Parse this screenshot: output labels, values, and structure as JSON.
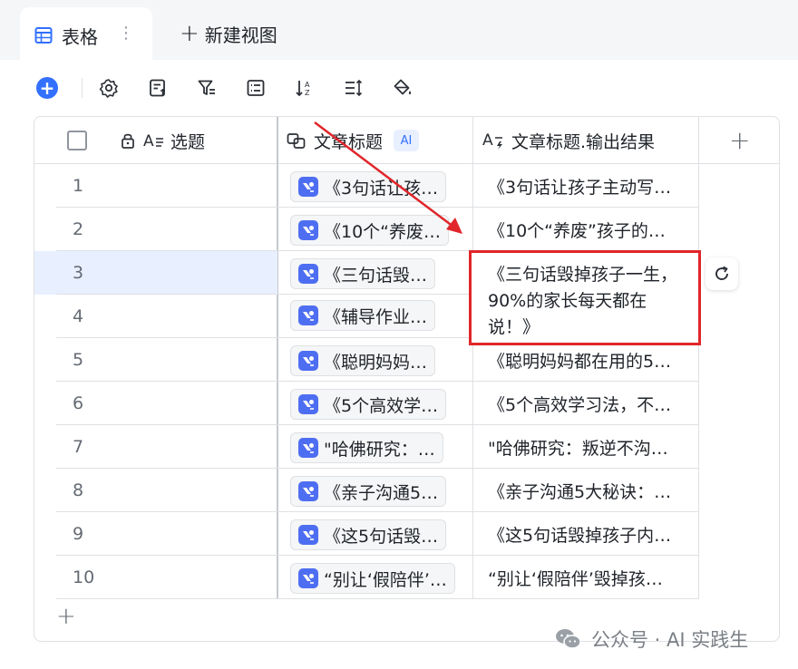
{
  "tabs": {
    "active_label": "表格",
    "more_label": "⋮",
    "new_view_label": "新建视图"
  },
  "toolbar": {
    "icons": [
      "add-record-icon",
      "settings-icon",
      "form-icon",
      "filter-icon",
      "group-icon",
      "sort-icon",
      "row-height-icon",
      "paint-icon"
    ]
  },
  "columns": {
    "topic": "选题",
    "title": "文章标题",
    "title_ai_badge": "AI",
    "output": "文章标题.输出结果"
  },
  "rows": [
    {
      "num": "1",
      "title": "《3句话让孩…",
      "output": "《3句话让孩子主动写…"
    },
    {
      "num": "2",
      "title": "《10个“养废…",
      "output": "《10个“养废”孩子的…"
    },
    {
      "num": "3",
      "title": "《三句话毁…",
      "output": ""
    },
    {
      "num": "4",
      "title": "《辅导作业…",
      "output": ""
    },
    {
      "num": "5",
      "title": "《聪明妈妈…",
      "output": "《聪明妈妈都在用的5…"
    },
    {
      "num": "6",
      "title": "《5个高效学…",
      "output": "《5个高效学习法，不…"
    },
    {
      "num": "7",
      "title": "\"哈佛研究：…",
      "output": "\"哈佛研究：叛逆不沟…"
    },
    {
      "num": "8",
      "title": "《亲子沟通5…",
      "output": "《亲子沟通5大秘诀：…"
    },
    {
      "num": "9",
      "title": "《这5句话毁…",
      "output": "《这5句话毁掉孩子内…"
    },
    {
      "num": "10",
      "title": "“别让‘假陪伴’…",
      "output": "“别让‘假陪伴’毁掉孩…"
    }
  ],
  "expanded_cell": {
    "text": "《三句话毁掉孩子一生，90%的家长每天都在说！》"
  },
  "watermark": {
    "text": "公众号 · AI 实践生"
  },
  "colors": {
    "accent": "#3370ff",
    "highlight_border": "#e0262b",
    "annotation_arrow": "#e0262b"
  }
}
